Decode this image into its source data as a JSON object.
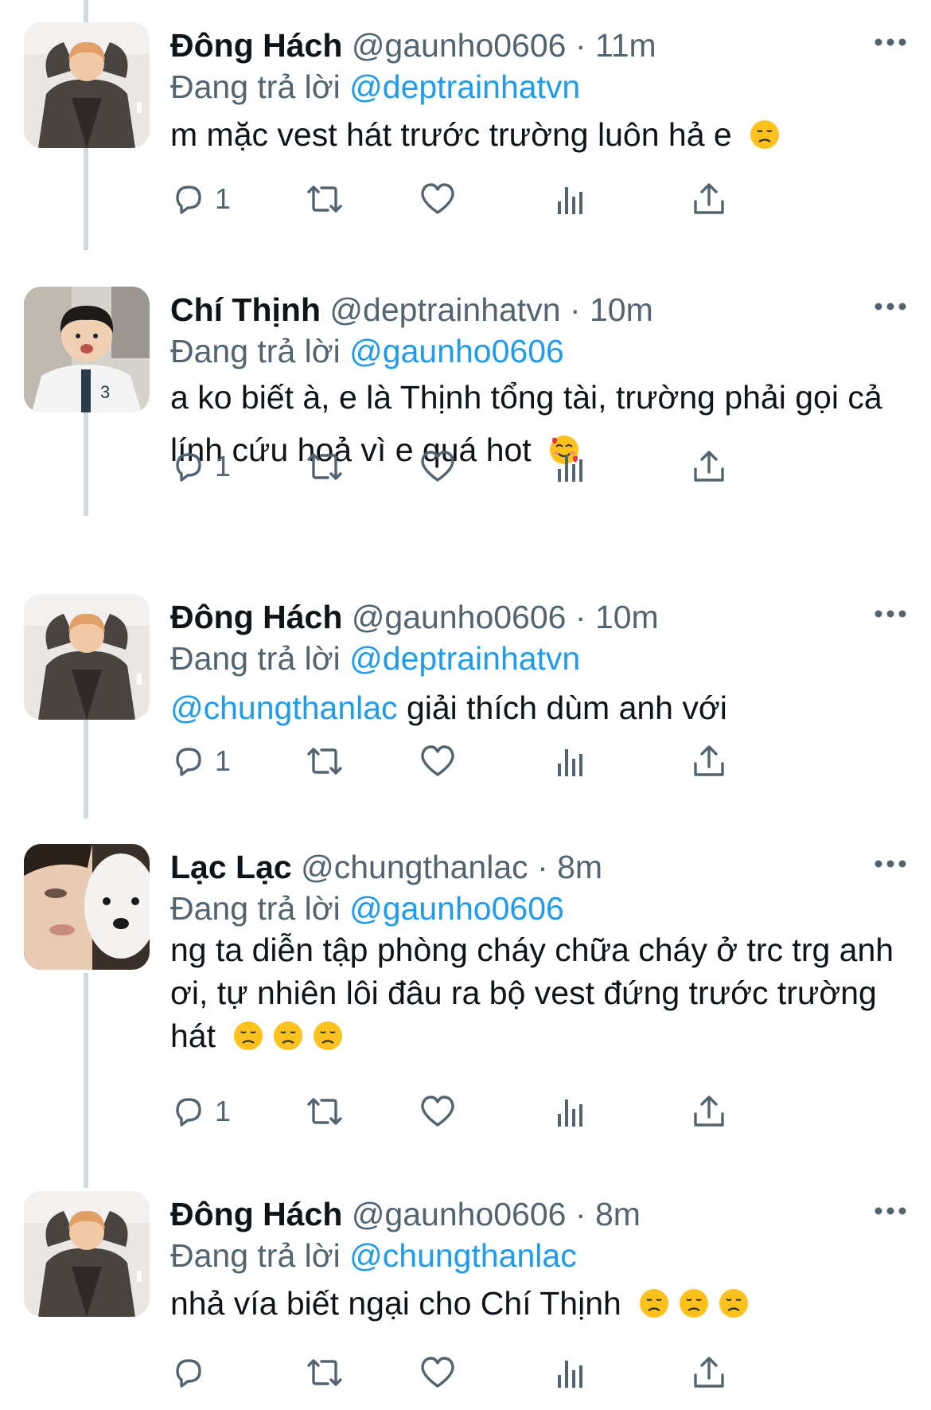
{
  "tweets": [
    {
      "name": "Đông Hách",
      "handle": "@gaunho0606",
      "separator": "·",
      "time": "11m",
      "reply_prefix": "Đang trả lời",
      "reply_to": "@deptrainhatvn",
      "text": "m mặc vest hát trước trường luôn hả e",
      "emojis": [
        "disappointed-face"
      ],
      "reply_count": "1"
    },
    {
      "name": "Chí Thịnh",
      "handle": "@deptrainhatvn",
      "separator": "·",
      "time": "10m",
      "reply_prefix": "Đang trả lời",
      "reply_to": "@gaunho0606",
      "text": "a ko biết à, e là Thịnh tổng tài, trường phải gọi cả lính cứu hoả vì e quá hot",
      "emojis": [
        "smiling-face-with-hearts"
      ],
      "reply_count": "1"
    },
    {
      "name": "Đông Hách",
      "handle": "@gaunho0606",
      "separator": "·",
      "time": "10m",
      "reply_prefix": "Đang trả lời",
      "reply_to": "@deptrainhatvn",
      "text_mention": "@chungthanlac",
      "text": " giải thích dùm anh với",
      "emojis": [],
      "reply_count": "1"
    },
    {
      "name": "Lạc Lạc",
      "handle": "@chungthanlac",
      "separator": "·",
      "time": "8m",
      "reply_prefix": "Đang trả lời",
      "reply_to": "@gaunho0606",
      "text": "ng ta diễn tập phòng cháy chữa cháy ở trc trg anh ơi, tự nhiên lôi đâu ra bộ vest đứng trước trường hát",
      "emojis": [
        "disappointed-face",
        "disappointed-face",
        "disappointed-face"
      ],
      "reply_count": "1"
    },
    {
      "name": "Đông Hách",
      "handle": "@gaunho0606",
      "separator": "·",
      "time": "8m",
      "reply_prefix": "Đang trả lời",
      "reply_to": "@chungthanlac",
      "text": "nhả vía biết ngại cho Chí Thịnh",
      "emojis": [
        "disappointed-face",
        "disappointed-face",
        "disappointed-face"
      ],
      "reply_count": ""
    }
  ],
  "icons": {
    "reply": "reply-icon",
    "retweet": "retweet-icon",
    "like": "heart-icon",
    "views": "views-icon",
    "share": "share-icon",
    "more": "more-icon"
  },
  "colors": {
    "text": "#0f1419",
    "secondary": "#536471",
    "link": "#1d9bf0",
    "thread_line": "#cfd9de"
  }
}
